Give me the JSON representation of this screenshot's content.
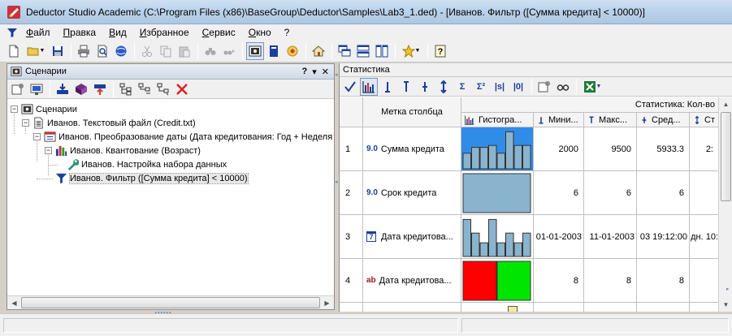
{
  "window": {
    "title": "Deductor Studio Academic (C:\\Program Files (x86)\\BaseGroup\\Deductor\\Samples\\Lab3_1.ded) - [Иванов. Фильтр ([Сумма кредита] < 10000)]"
  },
  "menu": {
    "items": [
      "Файл",
      "Правка",
      "Вид",
      "Избранное",
      "Сервис",
      "Окно",
      "?"
    ]
  },
  "left_panel": {
    "title": "Сценарии",
    "controls": {
      "help": "?",
      "pin": "▾",
      "close": "✕"
    },
    "tree": [
      {
        "label": "Сценарии",
        "icon": "scenarios-icon"
      },
      {
        "label": "Иванов. Текстовый файл (Credit.txt)",
        "icon": "text-file-icon"
      },
      {
        "label": "Иванов. Преобразование даты (Дата кредитования: Год + Неделя",
        "icon": "date-transform-icon"
      },
      {
        "label": "Иванов. Квантование (Возраст)",
        "icon": "quantization-icon"
      },
      {
        "label": "Иванов. Настройка набора данных",
        "icon": "wrench-icon"
      },
      {
        "label": "Иванов. Фильтр ([Сумма кредита] < 10000)",
        "icon": "filter-icon"
      }
    ]
  },
  "right_panel": {
    "title": "Статистика",
    "toolbar_labels": {
      "sigma": "Σ",
      "sigma2": "Σ²",
      "abs_s": "|s|",
      "abs_0": "|0|"
    },
    "grid": {
      "label_header": "Метка столбца",
      "group_header": "Статистика: Кол-во",
      "columns": [
        "Гистогра...",
        "Мини...",
        "Макс...",
        "Сред...",
        "Ст"
      ],
      "rows": [
        {
          "num": "1",
          "type": "9.0",
          "label": "Сумма кредита",
          "min": "2000",
          "max": "9500",
          "avg": "5933.3",
          "std": "2:",
          "hist": [
            0.4,
            0.55,
            0.55,
            0.6,
            0.4,
            0.95,
            0.6,
            0.6
          ]
        },
        {
          "num": "2",
          "type": "9.0",
          "label": "Срок кредита",
          "min": "6",
          "max": "6",
          "avg": "6",
          "std": "",
          "hist": [
            1.0
          ]
        },
        {
          "num": "3",
          "type": "7",
          "label": "Дата кредитова...",
          "min": "01-01-2003",
          "max": "11-01-2003",
          "avg": "03 19:12:00",
          "std": "дн. 10:",
          "hist": [
            0.95,
            0.6,
            0.35,
            0.95,
            0.35,
            0.6,
            0.35,
            0.6
          ]
        },
        {
          "num": "4",
          "type": "ab",
          "label": "Дата кредитова...",
          "min": "8",
          "max": "8",
          "avg": "8",
          "std": "",
          "hist_colors": [
            "#ff0000",
            "#00e600"
          ]
        }
      ]
    }
  },
  "colors": {
    "hist_fill": "#8ab4cd",
    "hist_selected_bg": "#2f8de8",
    "accent": "#1b3f9c"
  }
}
